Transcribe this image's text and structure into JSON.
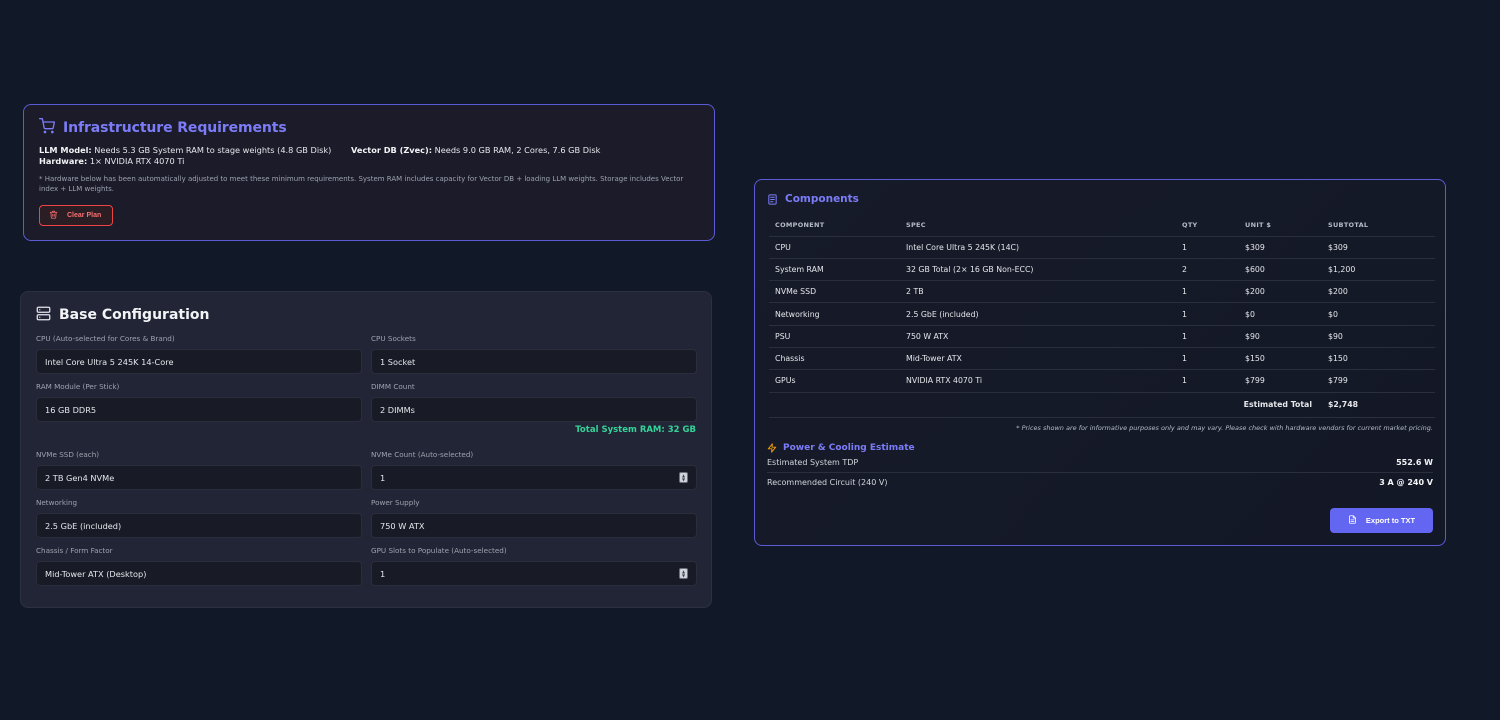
{
  "requirements": {
    "title": "Infrastructure Requirements",
    "llm_label": "LLM Model:",
    "llm_text": " Needs 5.3 GB System RAM to stage weights (4.8 GB Disk)",
    "vector_label": "Vector DB (Zvec):",
    "vector_text": " Needs 9.0 GB RAM, 2 Cores, 7.6 GB Disk",
    "hardware_label": "Hardware:",
    "hardware_text": " 1× NVIDIA RTX 4070 Ti",
    "note": "* Hardware below has been automatically adjusted to meet these minimum requirements. System RAM includes capacity for Vector DB + loading LLM weights. Storage includes Vector index + LLM weights.",
    "clear_button": "Clear Plan"
  },
  "base_config": {
    "title": "Base Configuration",
    "cpu": {
      "label": "CPU (Auto-selected for Cores & Brand)",
      "value": "Intel Core Ultra 5 245K 14-Core"
    },
    "sockets": {
      "label": "CPU Sockets",
      "value": "1 Socket"
    },
    "ram_module": {
      "label": "RAM Module (Per Stick)",
      "value": "16 GB DDR5"
    },
    "dimm_count": {
      "label": "DIMM Count",
      "value": "2 DIMMs"
    },
    "total_ram": "Total System RAM: 32 GB",
    "nvme": {
      "label": "NVMe SSD (each)",
      "value": "2 TB Gen4 NVMe"
    },
    "nvme_count": {
      "label": "NVMe Count (Auto-selected)",
      "value": "1"
    },
    "networking": {
      "label": "Networking",
      "value": "2.5 GbE (included)"
    },
    "psu": {
      "label": "Power Supply",
      "value": "750 W ATX"
    },
    "chassis": {
      "label": "Chassis / Form Factor",
      "value": "Mid-Tower ATX (Desktop)"
    },
    "gpu_slots": {
      "label": "GPU Slots to Populate (Auto-selected)",
      "value": "1"
    }
  },
  "components": {
    "title": "Components",
    "headers": [
      "COMPONENT",
      "SPEC",
      "QTY",
      "UNIT $",
      "SUBTOTAL"
    ],
    "rows": [
      [
        "CPU",
        "Intel Core Ultra 5 245K (14C)",
        "1",
        "$309",
        "$309"
      ],
      [
        "System RAM",
        "32 GB Total (2× 16 GB Non-ECC)",
        "2",
        "$600",
        "$1,200"
      ],
      [
        "NVMe SSD",
        "2 TB",
        "1",
        "$200",
        "$200"
      ],
      [
        "Networking",
        "2.5 GbE (included)",
        "1",
        "$0",
        "$0"
      ],
      [
        "PSU",
        "750 W ATX",
        "1",
        "$90",
        "$90"
      ],
      [
        "Chassis",
        "Mid-Tower ATX",
        "1",
        "$150",
        "$150"
      ],
      [
        "GPUs",
        "NVIDIA RTX 4070 Ti",
        "1",
        "$799",
        "$799"
      ]
    ],
    "total_label": "Estimated Total",
    "total_value": "$2,748",
    "price_note": "* Prices shown are for informative purposes only and may vary. Please check with hardware vendors for current market pricing.",
    "power_title": "Power & Cooling Estimate",
    "tdp_label": "Estimated System TDP",
    "tdp_value": "552.6 W",
    "circuit_label": "Recommended Circuit (240 V)",
    "circuit_value": "3 A @ 240 V",
    "export_button": "Export to TXT"
  },
  "colors": {
    "accent": "#7c7cf8",
    "success": "#34d399",
    "danger": "#f87171",
    "button": "#6366f1"
  },
  "icons": [
    "cart-icon",
    "trash-icon",
    "server-icon",
    "list-icon",
    "bolt-icon",
    "document-icon"
  ]
}
